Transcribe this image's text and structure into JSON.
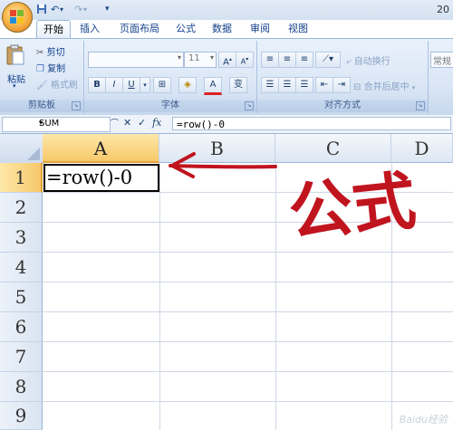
{
  "titlebar": {
    "title_fragment": "20"
  },
  "qat": {
    "separator": "▾"
  },
  "tabs": [
    {
      "label": "开始",
      "active": true
    },
    {
      "label": "插入",
      "active": false
    },
    {
      "label": "页面布局",
      "active": false
    },
    {
      "label": "公式",
      "active": false
    },
    {
      "label": "数据",
      "active": false
    },
    {
      "label": "审阅",
      "active": false
    },
    {
      "label": "视图",
      "active": false
    }
  ],
  "ribbon": {
    "clipboard": {
      "paste": "粘贴",
      "cut": "剪切",
      "copy": "复制",
      "format_painter": "格式刷",
      "label": "剪贴板"
    },
    "font": {
      "font_name": "",
      "font_size": "11",
      "grow": "A",
      "shrink": "A",
      "bold": "B",
      "italic": "I",
      "underline": "U",
      "font_color_letter": "A",
      "phonetic": "变",
      "label": "字体"
    },
    "alignment": {
      "wrap_text": "自动换行",
      "merge_center": "合并后居中",
      "label": "对齐方式"
    },
    "number": {
      "format": "常规"
    }
  },
  "formula_bar": {
    "name_box": "SUM",
    "fx": "fx",
    "cancel": "✕",
    "enter": "✓",
    "formula": "=row()-0"
  },
  "grid": {
    "columns": [
      "A",
      "B",
      "C",
      "D"
    ],
    "rows": [
      "1",
      "2",
      "3",
      "4",
      "5",
      "6",
      "7",
      "8",
      "9"
    ],
    "selected_column": "A",
    "selected_row": "1",
    "cell_a1_text": "=row()-0"
  },
  "annotation": {
    "label": "公式"
  },
  "watermark": "Baidu经验",
  "colors": {
    "ribbon_bg": "#dbe7f6",
    "selection": "#f7c86a",
    "annotation": "#c0141e"
  }
}
